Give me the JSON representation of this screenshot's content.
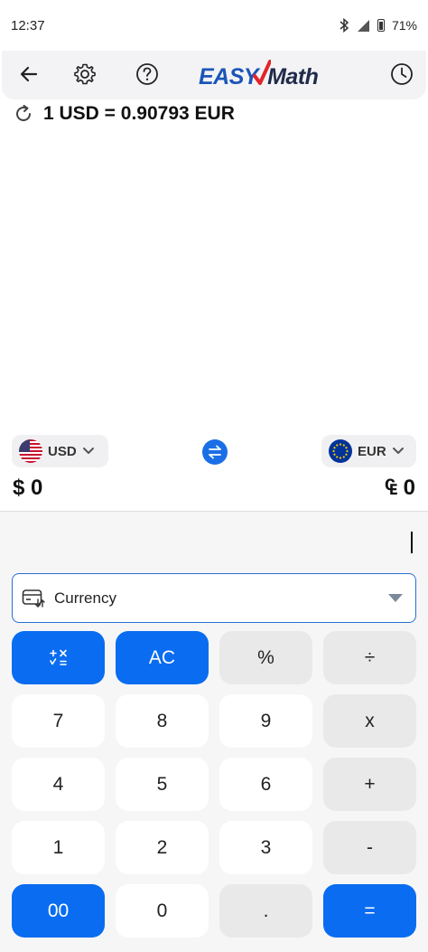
{
  "status_bar": {
    "time": "12:37",
    "battery": "71%"
  },
  "toolbar": {
    "logo_easy": "EASY",
    "logo_math": "Math",
    "icons": [
      "back-arrow-icon",
      "gear-icon",
      "help-icon",
      "history-icon"
    ]
  },
  "rate": {
    "text": "1 USD = 0.90793 EUR"
  },
  "from_currency": {
    "code": "USD",
    "symbol": "$",
    "amount": "0"
  },
  "to_currency": {
    "code": "EUR",
    "symbol": "₠",
    "amount": "0"
  },
  "mode_select": {
    "label": "Currency"
  },
  "keypad": {
    "row1": [
      "AC",
      "%",
      "÷"
    ],
    "row2": [
      "7",
      "8",
      "9",
      "x"
    ],
    "row3": [
      "4",
      "5",
      "6",
      "+"
    ],
    "row4": [
      "1",
      "2",
      "3",
      "-"
    ],
    "row5": [
      "00",
      "0",
      ".",
      "="
    ]
  },
  "colors": {
    "accent": "#0a6cf0",
    "key_grey": "#e9e9ea",
    "panel": "#f6f6f7"
  }
}
